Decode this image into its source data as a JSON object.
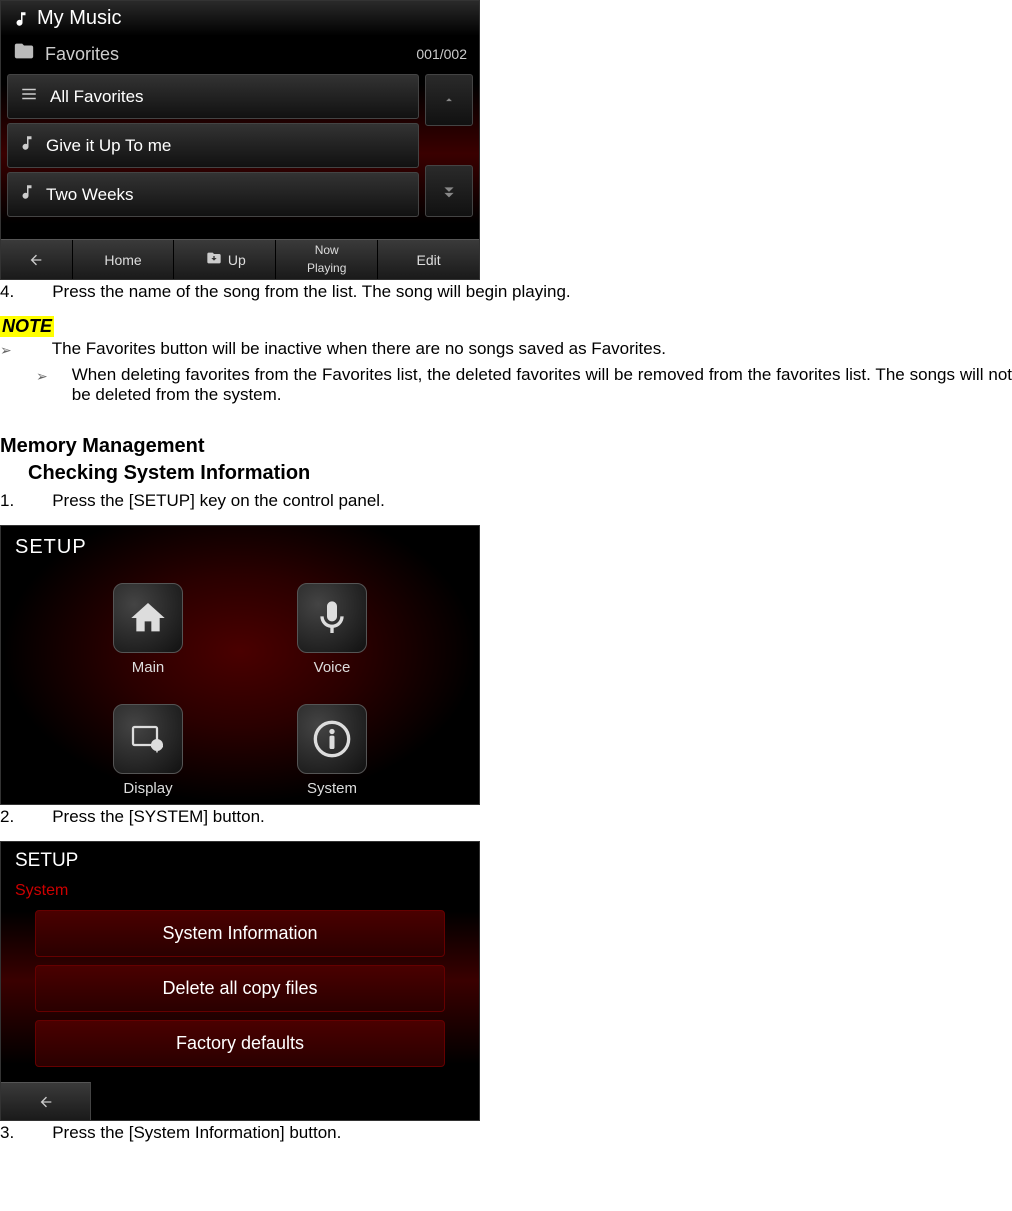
{
  "screen1": {
    "title": "My Music",
    "subtitle": "Favorites",
    "page_counter": "001/002",
    "items": [
      "All Favorites",
      "Give it Up To me",
      "Two Weeks"
    ],
    "bottom_home": "Home",
    "bottom_up": "Up",
    "bottom_now1": "Now",
    "bottom_now2": "Playing",
    "bottom_edit": "Edit"
  },
  "step4": {
    "num": "4.",
    "text": "Press the name of the song from the list. The song will begin playing."
  },
  "note": {
    "label": "NOTE",
    "bullet1": "The Favorites button will be inactive when there are no songs saved as Favorites.",
    "bullet2": "When deleting favorites from the Favorites list, the deleted favorites will be removed from the favorites list. The songs will not be deleted from the system."
  },
  "section": {
    "heading": "Memory Management",
    "subheading": "Checking System Information"
  },
  "step1": {
    "num": "1.",
    "text": "Press the [SETUP] key on the control panel."
  },
  "screen2": {
    "title": "SETUP",
    "tiles": [
      "Main",
      "Voice",
      "Display",
      "System"
    ]
  },
  "step2": {
    "num": "2.",
    "text": "Press the [SYSTEM] button."
  },
  "screen3": {
    "title": "SETUP",
    "subtitle": "System",
    "buttons": [
      "System Information",
      "Delete all copy files",
      "Factory defaults"
    ]
  },
  "step3": {
    "num": "3.",
    "text": "Press the [System Information] button."
  }
}
